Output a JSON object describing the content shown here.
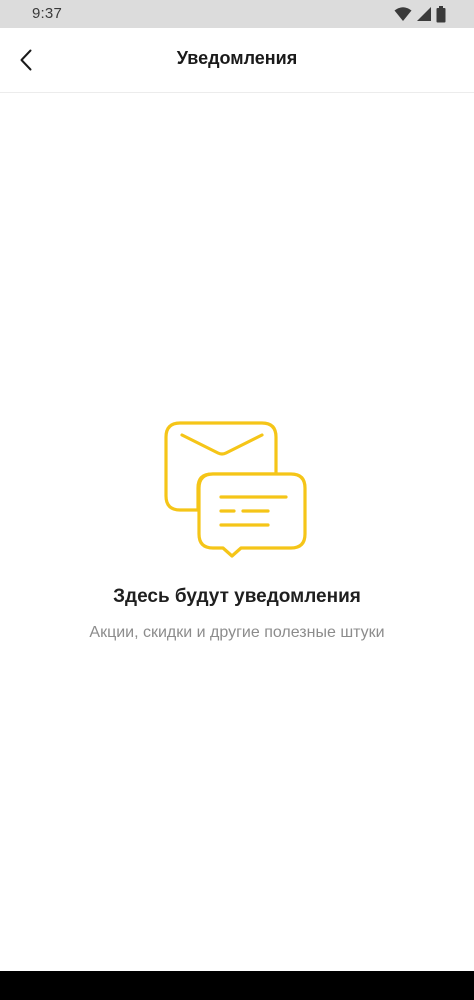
{
  "status_bar": {
    "time": "9:37",
    "icons": [
      "wifi-icon",
      "signal-icon",
      "battery-icon"
    ]
  },
  "header": {
    "title": "Уведомления",
    "back_icon": "chevron-left-icon"
  },
  "empty_state": {
    "illustration": "notification-messages-icon",
    "title": "Здесь будут уведомления",
    "subtitle": "Акции, скидки и другие полезные штуки"
  },
  "colors": {
    "accent": "#F5C518",
    "status_bar_bg": "#DCDCDC",
    "title_text": "#1F1F1F",
    "subtitle_text": "#8C8C8C",
    "nav_bar": "#000000"
  }
}
